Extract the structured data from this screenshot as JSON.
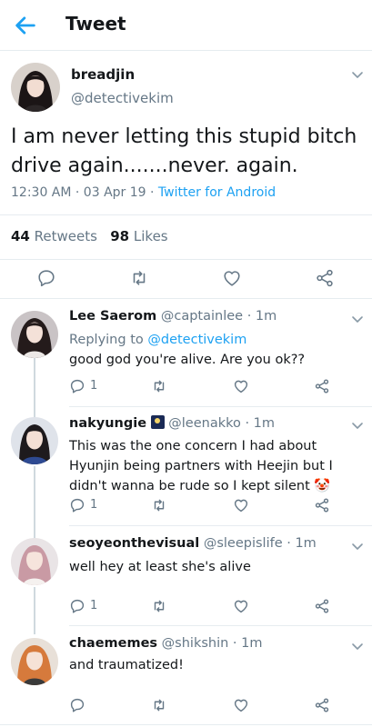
{
  "header": {
    "title": "Tweet"
  },
  "tweet": {
    "author_name": "breadjin",
    "author_handle": "@detectivekim",
    "text": "I am never letting this stupid bitch drive again.......never. again.",
    "time": "12:30 AM · 03 Apr 19 · ",
    "source": "Twitter for Android",
    "retweets": "44",
    "retweets_label": "Retweets",
    "likes": "98",
    "likes_label": "Likes"
  },
  "replies": [
    {
      "name": "Lee Saerom",
      "handle": "@captainlee · 1m",
      "replying_prefix": "Replying to ",
      "replying_to": "@detectivekim",
      "text": "good god you're alive. Are you ok??",
      "reply_count": "1"
    },
    {
      "name": "nakyungie",
      "handle": "@leenakko · 1m",
      "text_lines": [
        "This was the one concern I had about",
        "Hyunjin being partners with Heejin but I",
        "didn't wanna be rude so I kept silent 🤡"
      ],
      "reply_count": "1"
    },
    {
      "name": "seoyeonthevisual",
      "handle": "@sleepislife · 1m",
      "text": "well hey at least she's alive",
      "reply_count": "1"
    },
    {
      "name": "chaememes",
      "handle": "@shikshin · 1m",
      "text": "and traumatized!"
    }
  ],
  "colors": {
    "accent": "#1da1f2",
    "text": "#14171a",
    "muted": "#657786",
    "divider": "#e6ecf0"
  }
}
